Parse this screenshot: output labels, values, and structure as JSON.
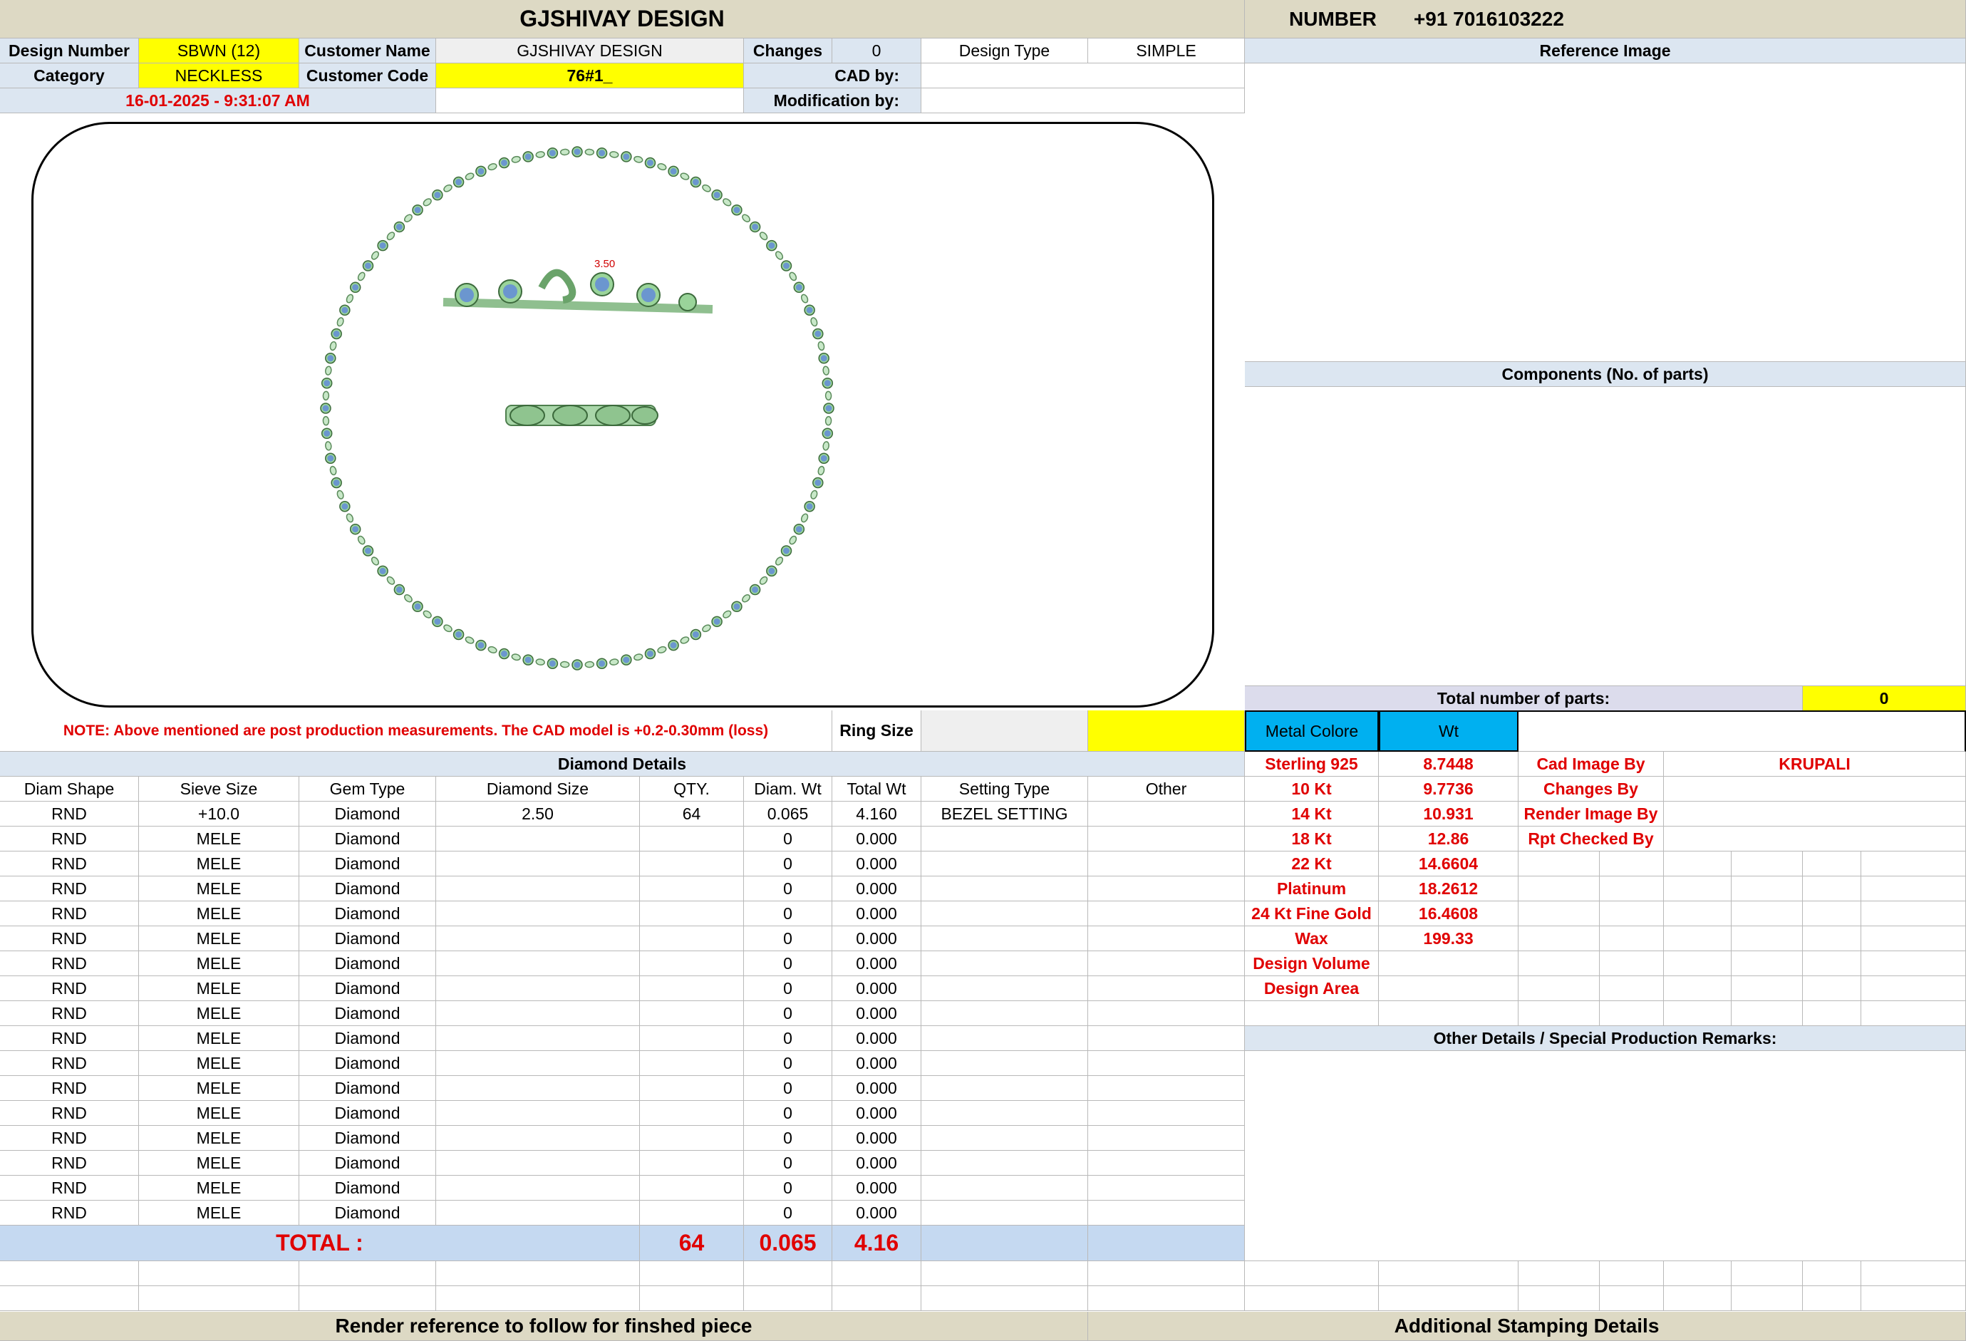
{
  "header": {
    "company": "GJSHIVAY DESIGN",
    "number_label": "NUMBER",
    "number_value": "+91 7016103222"
  },
  "info": {
    "design_number_label": "Design Number",
    "design_number": "SBWN (12)",
    "customer_name_label": "Customer Name",
    "customer_name": "GJSHIVAY DESIGN",
    "changes_label": "Changes",
    "changes": "0",
    "design_type_label": "Design Type",
    "design_type": "SIMPLE",
    "category_label": "Category",
    "category": "NECKLESS",
    "customer_code_label": "Customer Code",
    "customer_code": "76#1_",
    "cad_by_label": "CAD by:",
    "modification_by_label": "Modification by:",
    "timestamp": "16-01-2025 - 9:31:07 AM"
  },
  "reference_image_label": "Reference Image",
  "components_label": "Components (No. of parts)",
  "total_parts_label": "Total number of parts:",
  "total_parts": "0",
  "drawing": {
    "dimension_label": "3.50"
  },
  "note": "NOTE: Above mentioned are post production measurements. The CAD model is +0.2-0.30mm (loss)",
  "ring_size_label": "Ring Size",
  "metal": {
    "col_label": "Metal Colore",
    "wt_label": "Wt",
    "rows": [
      {
        "name": "Sterling 925",
        "wt": "8.7448"
      },
      {
        "name": "10 Kt",
        "wt": "9.7736"
      },
      {
        "name": "14 Kt",
        "wt": "10.931"
      },
      {
        "name": "18 Kt",
        "wt": "12.86"
      },
      {
        "name": "22 Kt",
        "wt": "14.6604"
      },
      {
        "name": "Platinum",
        "wt": "18.2612"
      },
      {
        "name": "24 Kt Fine Gold",
        "wt": "16.4608"
      },
      {
        "name": "Wax",
        "wt": "199.33"
      },
      {
        "name": "Design Volume",
        "wt": ""
      },
      {
        "name": "Design Area",
        "wt": ""
      }
    ]
  },
  "staff": [
    {
      "label": "Cad Image By",
      "value": "KRUPALI"
    },
    {
      "label": "Changes By",
      "value": ""
    },
    {
      "label": "Render Image By",
      "value": ""
    },
    {
      "label": "Rpt Checked By",
      "value": ""
    }
  ],
  "other_details_label": "Other Details / Special Production Remarks:",
  "diamond": {
    "title": "Diamond Details",
    "headers": [
      "Diam Shape",
      "Sieve Size",
      "Gem Type",
      "Diamond Size",
      "QTY.",
      "Diam. Wt",
      "Total Wt",
      "Setting Type",
      "Other"
    ],
    "rows": [
      [
        "RND",
        "+10.0",
        "Diamond",
        "2.50",
        "64",
        "0.065",
        "4.160",
        "BEZEL SETTING",
        ""
      ],
      [
        "RND",
        "MELE",
        "Diamond",
        "",
        "",
        "0",
        "0.000",
        "",
        ""
      ],
      [
        "RND",
        "MELE",
        "Diamond",
        "",
        "",
        "0",
        "0.000",
        "",
        ""
      ],
      [
        "RND",
        "MELE",
        "Diamond",
        "",
        "",
        "0",
        "0.000",
        "",
        ""
      ],
      [
        "RND",
        "MELE",
        "Diamond",
        "",
        "",
        "0",
        "0.000",
        "",
        ""
      ],
      [
        "RND",
        "MELE",
        "Diamond",
        "",
        "",
        "0",
        "0.000",
        "",
        ""
      ],
      [
        "RND",
        "MELE",
        "Diamond",
        "",
        "",
        "0",
        "0.000",
        "",
        ""
      ],
      [
        "RND",
        "MELE",
        "Diamond",
        "",
        "",
        "0",
        "0.000",
        "",
        ""
      ],
      [
        "RND",
        "MELE",
        "Diamond",
        "",
        "",
        "0",
        "0.000",
        "",
        ""
      ],
      [
        "RND",
        "MELE",
        "Diamond",
        "",
        "",
        "0",
        "0.000",
        "",
        ""
      ],
      [
        "RND",
        "MELE",
        "Diamond",
        "",
        "",
        "0",
        "0.000",
        "",
        ""
      ],
      [
        "RND",
        "MELE",
        "Diamond",
        "",
        "",
        "0",
        "0.000",
        "",
        ""
      ],
      [
        "RND",
        "MELE",
        "Diamond",
        "",
        "",
        "0",
        "0.000",
        "",
        ""
      ],
      [
        "RND",
        "MELE",
        "Diamond",
        "",
        "",
        "0",
        "0.000",
        "",
        ""
      ],
      [
        "RND",
        "MELE",
        "Diamond",
        "",
        "",
        "0",
        "0.000",
        "",
        ""
      ],
      [
        "RND",
        "MELE",
        "Diamond",
        "",
        "",
        "0",
        "0.000",
        "",
        ""
      ],
      [
        "RND",
        "MELE",
        "Diamond",
        "",
        "",
        "0",
        "0.000",
        "",
        ""
      ]
    ],
    "total_label": "TOTAL :",
    "total_qty": "64",
    "total_diam_wt": "0.065",
    "total_wt": "4.16"
  },
  "footer": {
    "render_ref": "Render reference to follow for finshed piece",
    "stamping": "Additional Stamping Details"
  },
  "colors": {
    "header_bg": "#ddd9c4",
    "label_bg": "#dce6f1",
    "highlight": "#ffff00",
    "metal_header": "#00b0f0",
    "total_bg": "#c5d9f1",
    "red_text": "#e00000"
  }
}
